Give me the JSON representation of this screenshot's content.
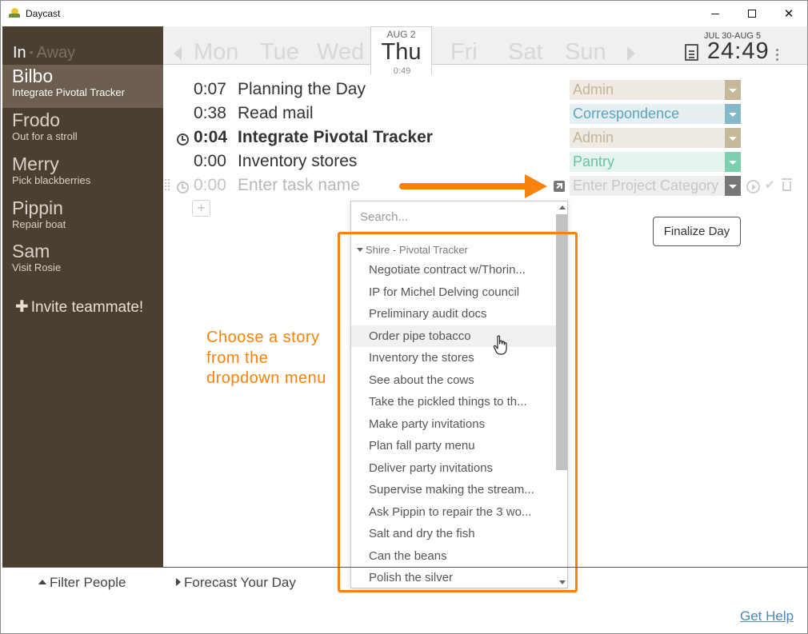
{
  "window": {
    "title": "Daycast"
  },
  "status": {
    "in": "In",
    "separator": "•",
    "away": "Away"
  },
  "people": [
    {
      "name": "Bilbo",
      "task": "Integrate Pivotal Tracker",
      "active": true
    },
    {
      "name": "Frodo",
      "task": "Out for a stroll",
      "active": false
    },
    {
      "name": "Merry",
      "task": "Pick blackberries",
      "active": false
    },
    {
      "name": "Pippin",
      "task": "Repair boat",
      "active": false
    },
    {
      "name": "Sam",
      "task": "Visit Rosie",
      "active": false
    }
  ],
  "invite": {
    "label": "Invite teammate!"
  },
  "days": {
    "mon": "Mon",
    "tue": "Tue",
    "wed": "Wed",
    "selected": {
      "date": "AUG 2",
      "name": "Thu",
      "total": "0:49"
    },
    "fri": "Fri",
    "sat": "Sat",
    "sun": "Sun"
  },
  "week": {
    "range": "JUL 30-AUG 5",
    "total": "24:49"
  },
  "tasks": [
    {
      "time": "0:07",
      "name": "Planning the Day",
      "category": "Admin"
    },
    {
      "time": "0:38",
      "name": "Read mail",
      "category": "Correspondence"
    },
    {
      "time": "0:04",
      "name": "Integrate Pivotal Tracker",
      "category": "Admin"
    },
    {
      "time": "0:00",
      "name": "Inventory stores",
      "category": "Pantry"
    }
  ],
  "new_task": {
    "time": "0:00",
    "placeholder": "Enter task name",
    "category_placeholder": "Enter Project Category"
  },
  "add_button": "+",
  "finalize": "Finalize Day",
  "callout": "Choose a story from the dropdown menu",
  "dropdown": {
    "search_placeholder": "Search...",
    "group": "Shire - Pivotal Tracker",
    "items": [
      "Negotiate contract w/Thorin...",
      "IP for Michel Delving council",
      "Preliminary audit docs",
      "Order pipe tobacco",
      "Inventory the stores",
      "See about the cows",
      "Take the pickled things to th...",
      "Make party invitations",
      "Plan fall party menu",
      "Deliver party invitations",
      "Supervise making the stream...",
      "Ask Pippin to repair the 3 wo...",
      "Salt and dry the fish",
      "Can the beans",
      "Polish the silver"
    ],
    "hovered_index": 3
  },
  "bottom": {
    "filter": "Filter People",
    "forecast": "Forecast Your Day",
    "help": "Get Help"
  },
  "colors": {
    "accent": "#f7820e",
    "sidebar": "#4b3f32",
    "link": "#4a89b5"
  }
}
